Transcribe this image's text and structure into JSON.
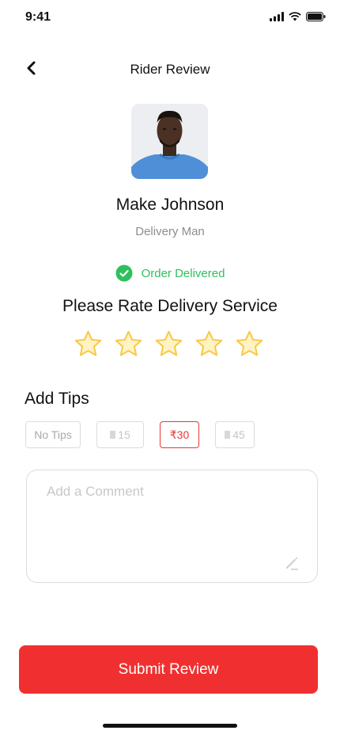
{
  "status_bar": {
    "time": "9:41",
    "icons": [
      "signal-icon",
      "wifi-icon",
      "battery-icon"
    ]
  },
  "header": {
    "title": "Rider Review",
    "back_icon": "chevron-left-icon"
  },
  "rider": {
    "name": "Make Johnson",
    "role": "Delivery Man"
  },
  "order": {
    "status": "Order Delivered",
    "status_icon": "check-circle-icon",
    "status_color": "#2fbf5d"
  },
  "rating": {
    "title": "Please Rate Delivery Service",
    "max": 5,
    "value": 0,
    "star_color": "#f7c948"
  },
  "tips": {
    "title": "Add Tips",
    "options": [
      {
        "label": "No Tips",
        "selected": false
      },
      {
        "label": "15",
        "selected": false
      },
      {
        "label": "₹30",
        "selected": true
      },
      {
        "label": "45",
        "selected": false
      }
    ]
  },
  "comment": {
    "placeholder": "Add a Comment",
    "value": ""
  },
  "submit": {
    "label": "Submit Review",
    "color": "#f03030"
  }
}
